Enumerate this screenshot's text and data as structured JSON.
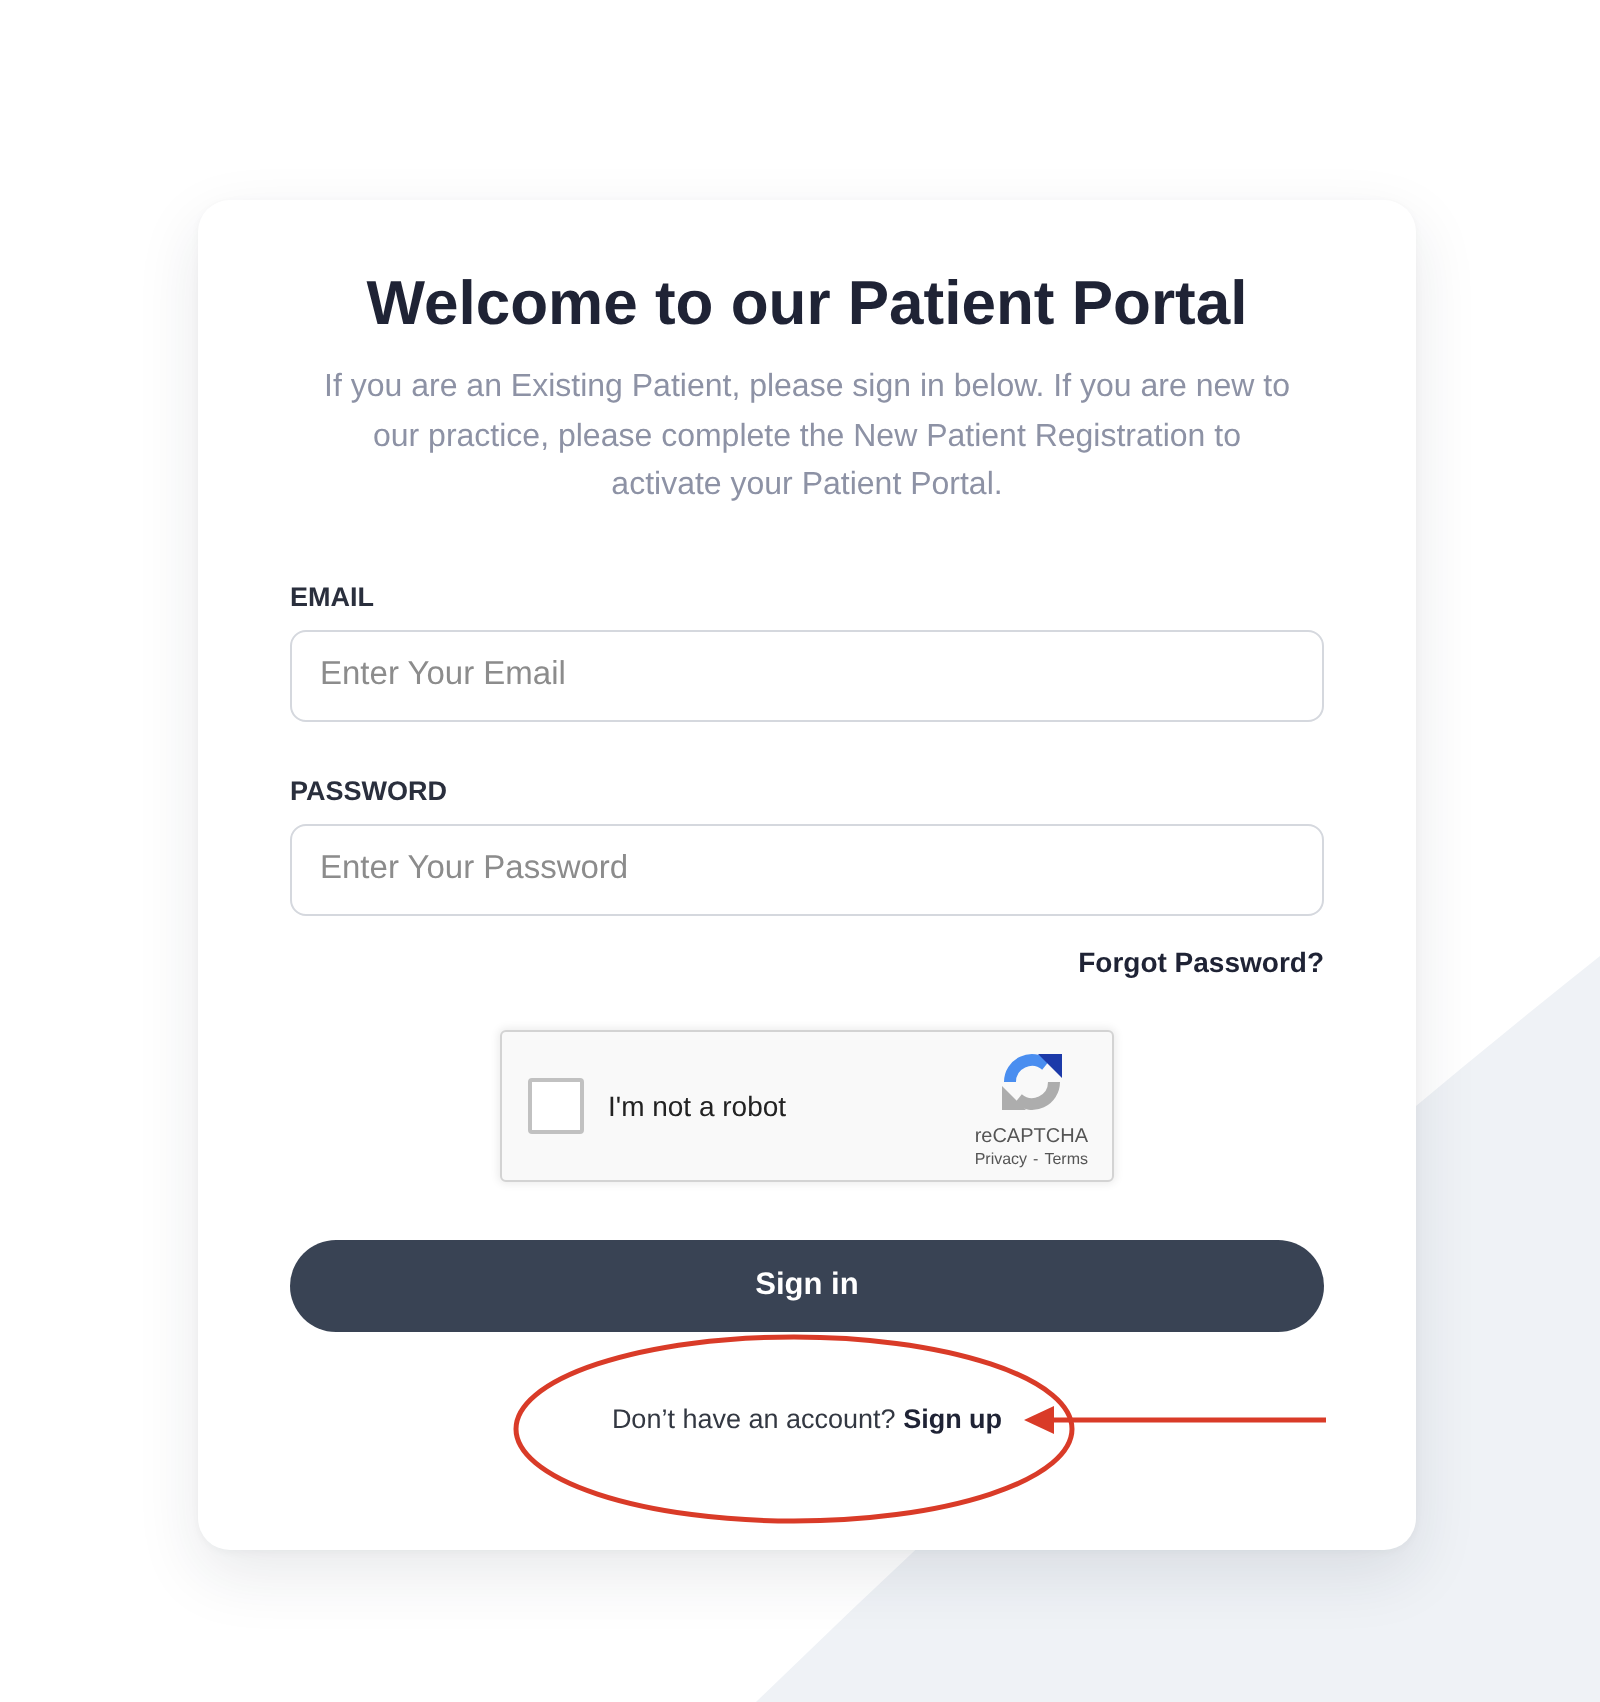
{
  "card": {
    "title": "Welcome to our Patient Portal",
    "intro": "If you are an Existing Patient, please sign in below. If you are new to our practice, please complete the New Patient Registration to activate your Patient Portal."
  },
  "fields": [
    {
      "label": "EMAIL",
      "placeholder": "Enter Your Email"
    },
    {
      "label": "PASSWORD",
      "placeholder": "Enter Your Password"
    }
  ],
  "forgot_link": "Forgot Password?",
  "captcha": {
    "label": "I'm not a robot",
    "checked": false,
    "brand": "reCAPTCHA",
    "links": [
      "Privacy",
      "Terms"
    ],
    "separator": "-"
  },
  "submit_button": "Sign in",
  "signup_prompt": {
    "text": "Don’t have an account?",
    "link": "Sign up"
  },
  "annotation": {
    "kind": "circled-with-arrow"
  }
}
